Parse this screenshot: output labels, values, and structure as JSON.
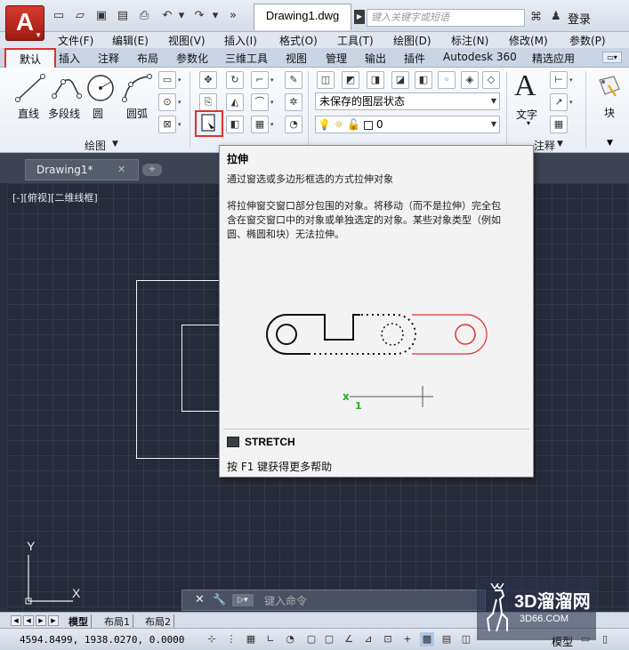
{
  "titlebar": {
    "logo_letter": "A",
    "doc_title": "Drawing1.dwg",
    "search_placeholder": "键入关键字或短语",
    "login": "登录"
  },
  "menu": [
    "文件(F)",
    "编辑(E)",
    "视图(V)",
    "插入(I)",
    "格式(O)",
    "工具(T)",
    "绘图(D)",
    "标注(N)",
    "修改(M)",
    "参数(P)"
  ],
  "ribbon_tabs": {
    "active": "默认",
    "others": [
      "插入",
      "注释",
      "布局",
      "参数化",
      "三维工具",
      "视图",
      "管理",
      "输出",
      "插件",
      "Autodesk 360",
      "精选应用"
    ]
  },
  "ribbon": {
    "draw_tools": [
      "直线",
      "多段线",
      "圆",
      "圆弧"
    ],
    "draw_panel_title": "绘图",
    "layer_state": "未保存的图层状态",
    "layer_current": "0",
    "text_label": "文字",
    "annotate_partial": "注释",
    "block_label": "块"
  },
  "drawing_tab": {
    "label": "Drawing1*"
  },
  "canvas": {
    "view_label": "[-][俯视][二维线框]",
    "ucs_x": "X",
    "ucs_y": "Y"
  },
  "tooltip": {
    "title": "拉伸",
    "description": "通过窗选或多边形框选的方式拉伸对象",
    "detail_lines": [
      "将拉伸窗交窗口部分包围的对象。将移动（而不是拉伸）完全包",
      "含在窗交窗口中的对象或单独选定的对象。某些对象类型（例如",
      "圆、椭圆和块）无法拉伸。"
    ],
    "illus_marker": "x",
    "illus_number": "1",
    "command": "STRETCH",
    "help": "按 F1 键获得更多帮助"
  },
  "command_line": {
    "placeholder": "键入命令"
  },
  "layout_tabs": [
    "模型",
    "布局1",
    "布局2"
  ],
  "status": {
    "coords": "4594.8499, 1938.0270, 0.0000",
    "model": "模型"
  },
  "watermark": {
    "brand": "3D溜溜网",
    "url": "3D66.COM"
  },
  "colors": {
    "highlight_red": "#e0312a",
    "canvas_bg": "#252b38",
    "tooltip_red_line": "#e03030",
    "green_marker": "#2da82d"
  }
}
